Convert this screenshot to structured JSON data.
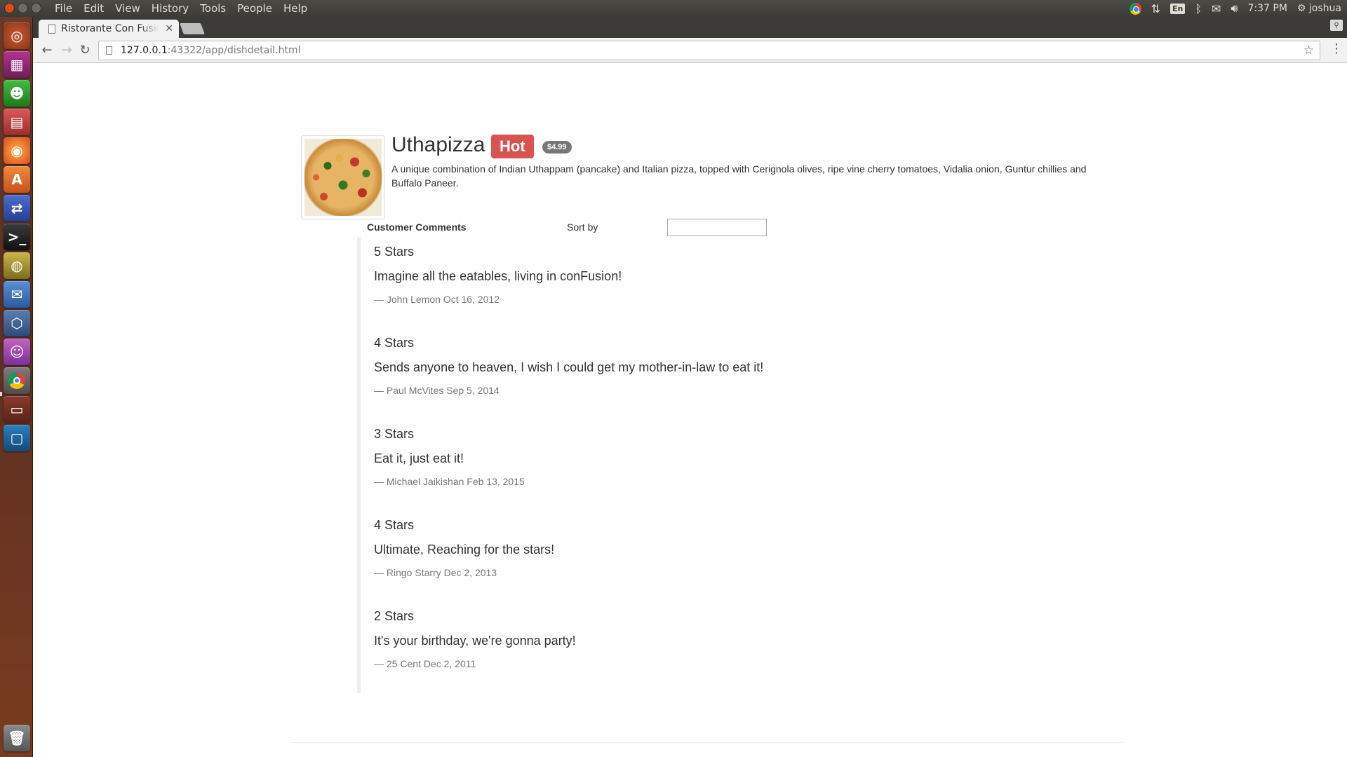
{
  "top_panel": {
    "menu": [
      "File",
      "Edit",
      "View",
      "History",
      "Tools",
      "People",
      "Help"
    ],
    "keyboard_layout": "En",
    "time": "7:37 PM",
    "user": "joshua"
  },
  "browser": {
    "tab_title": "Ristorante Con Fusion",
    "url_host": "127.0.0.1",
    "url_path": ":43322/app/dishdetail.html"
  },
  "dish": {
    "name": "Uthapizza",
    "label": "Hot",
    "price": "$4.99",
    "description": "A unique combination of Indian Uthappam (pancake) and Italian pizza, topped with Cerignola olives, ripe vine cherry tomatoes, Vidalia onion, Guntur chillies and Buffalo Paneer."
  },
  "comments_section": {
    "heading": "Customer Comments",
    "sort_label": "Sort by",
    "sort_value": ""
  },
  "comments": [
    {
      "stars": "5 Stars",
      "text": "Imagine all the eatables, living in conFusion!",
      "footer": "— John Lemon Oct 16, 2012"
    },
    {
      "stars": "4 Stars",
      "text": "Sends anyone to heaven, I wish I could get my mother-in-law to eat it!",
      "footer": "— Paul McVites Sep 5, 2014"
    },
    {
      "stars": "3 Stars",
      "text": "Eat it, just eat it!",
      "footer": "— Michael Jaikishan Feb 13, 2015"
    },
    {
      "stars": "4 Stars",
      "text": "Ultimate, Reaching for the stars!",
      "footer": "— Ringo Starry Dec 2, 2013"
    },
    {
      "stars": "2 Stars",
      "text": "It's your birthday, we're gonna party!",
      "footer": "— 25 Cent Dec 2, 2011"
    }
  ],
  "colors": {
    "label_danger": "#d9534f",
    "badge_default": "#777777",
    "panel_bg": "#3c3b37",
    "launcher_bg": "#5a2f22"
  }
}
